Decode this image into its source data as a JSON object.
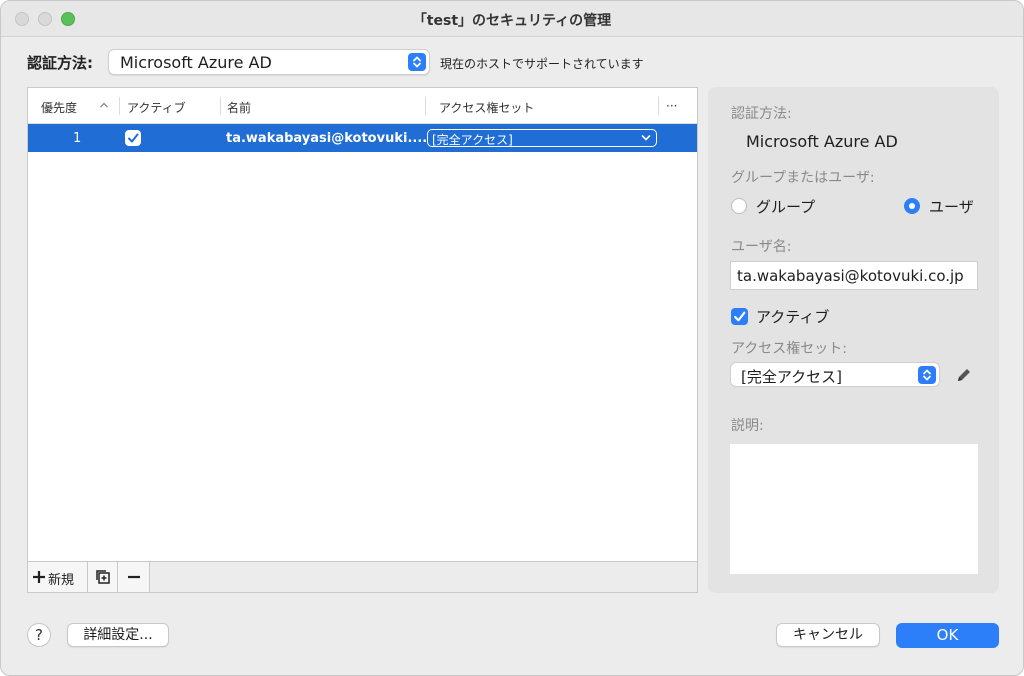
{
  "window": {
    "title": "「test」のセキュリティの管理"
  },
  "auth": {
    "label": "認証方法:",
    "selected": "Microsoft Azure AD",
    "note": "現在のホストでサポートされています"
  },
  "table": {
    "columns": {
      "priority": "優先度",
      "active": "アクティブ",
      "name": "名前",
      "access_set": "アクセス権セット",
      "more": "···"
    },
    "rows": [
      {
        "priority": "1",
        "active": true,
        "name": "ta.wakabayasi@kotovuki....",
        "access_set": "[完全アクセス]"
      }
    ],
    "footer": {
      "new_label": "新規"
    }
  },
  "panel": {
    "auth_label": "認証方法:",
    "auth_value": "Microsoft Azure AD",
    "group_or_user_label": "グループまたはユーザ:",
    "radio_group": "グループ",
    "radio_user": "ユーザ",
    "selected_radio": "user",
    "username_label": "ユーザ名:",
    "username_value": "ta.wakabayasi@kotovuki.co.jp",
    "active_label": "アクティブ",
    "access_set_label": "アクセス権セット:",
    "access_set_value": "[完全アクセス]",
    "description_label": "説明:",
    "description_value": ""
  },
  "buttons": {
    "help": "?",
    "advanced": "詳細設定...",
    "cancel": "キャンセル",
    "ok": "OK"
  },
  "colors": {
    "accent": "#2d7ff9",
    "selection": "#1f6dd5"
  }
}
